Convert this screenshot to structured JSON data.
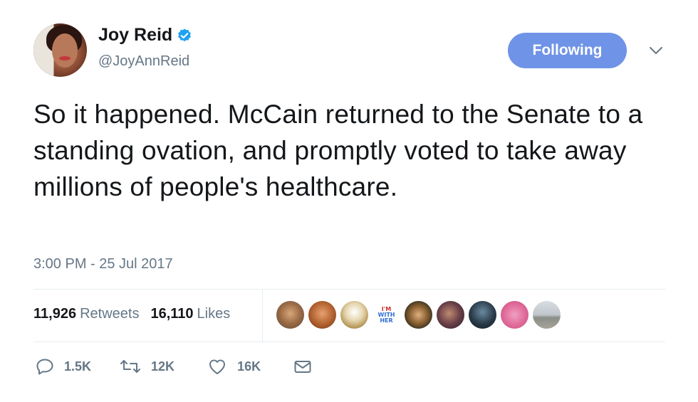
{
  "author": {
    "display_name": "Joy Reid",
    "handle": "@JoyAnnReid",
    "verified": true,
    "avatar_icon": "profile-photo"
  },
  "follow_button": {
    "label": "Following",
    "color": "#6f93e6"
  },
  "tweet": {
    "text": "So it happened. McCain returned to the Senate to a standing ovation, and promptly voted to take away millions of people's healthcare.",
    "timestamp": "3:00 PM - 25 Jul 2017"
  },
  "stats": {
    "retweets_count": "11,926",
    "retweets_label": "Retweets",
    "likes_count": "16,110",
    "likes_label": "Likes"
  },
  "liker_avatars": [
    {
      "icon": "user-avatar"
    },
    {
      "icon": "user-avatar"
    },
    {
      "icon": "user-avatar"
    },
    {
      "icon": "imwithher-avatar",
      "line1": "I'M",
      "line2": "WITH",
      "line3": "HER"
    },
    {
      "icon": "user-avatar"
    },
    {
      "icon": "user-avatar"
    },
    {
      "icon": "user-avatar"
    },
    {
      "icon": "user-avatar"
    },
    {
      "icon": "user-avatar"
    }
  ],
  "actions": {
    "reply_count": "1.5K",
    "retweet_count": "12K",
    "like_count": "16K"
  },
  "colors": {
    "text": "#14171a",
    "secondary": "#657786",
    "verified_blue": "#1da1f2",
    "divider": "#e6ecf0"
  }
}
